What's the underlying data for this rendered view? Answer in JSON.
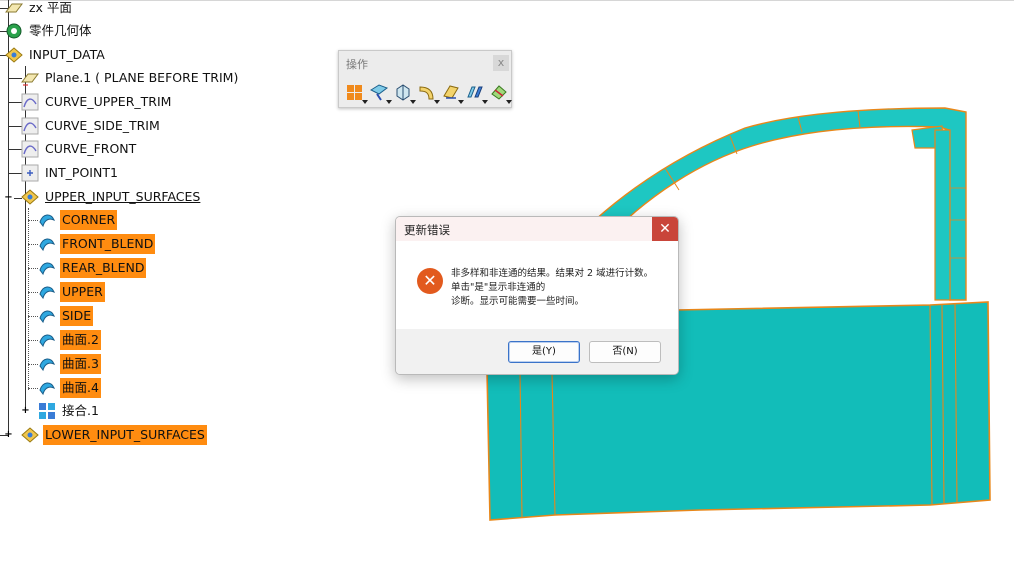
{
  "tree": {
    "items": [
      {
        "label": "zx 平面",
        "icon": "plane-icon",
        "highlight": false
      },
      {
        "label": "零件几何体",
        "icon": "part-body-icon",
        "highlight": false
      },
      {
        "label": "INPUT_DATA",
        "icon": "geometrical-set-icon",
        "highlight": false
      },
      {
        "label": "Plane.1 ( PLANE BEFORE TRIM)",
        "icon": "plane-icon",
        "highlight": false
      },
      {
        "label": "CURVE_UPPER_TRIM",
        "icon": "curve-icon",
        "highlight": false
      },
      {
        "label": "CURVE_SIDE_TRIM",
        "icon": "curve-icon",
        "highlight": false
      },
      {
        "label": "CURVE_FRONT",
        "icon": "curve-icon",
        "highlight": false
      },
      {
        "label": "INT_POINT1",
        "icon": "point-icon",
        "highlight": false
      },
      {
        "label": "UPPER_INPUT_SURFACES",
        "icon": "geometrical-set-icon",
        "highlight": false,
        "underline": true
      },
      {
        "label": "CORNER",
        "icon": "surface-icon",
        "highlight": true
      },
      {
        "label": "FRONT_BLEND",
        "icon": "surface-icon",
        "highlight": true
      },
      {
        "label": "REAR_BLEND",
        "icon": "surface-icon",
        "highlight": true
      },
      {
        "label": "UPPER",
        "icon": "surface-icon",
        "highlight": true
      },
      {
        "label": "SIDE",
        "icon": "surface-icon",
        "highlight": true
      },
      {
        "label": "曲面.2",
        "icon": "surface-icon",
        "highlight": true
      },
      {
        "label": "曲面.3",
        "icon": "surface-icon",
        "highlight": true
      },
      {
        "label": "曲面.4",
        "icon": "surface-icon",
        "highlight": true
      },
      {
        "label": "接合.1",
        "icon": "join-icon",
        "highlight": false
      },
      {
        "label": "LOWER_INPUT_SURFACES",
        "icon": "geometrical-set-icon",
        "highlight": true
      }
    ]
  },
  "toolbar": {
    "title": "操作",
    "close": "x",
    "buttons": [
      {
        "name": "join-tool-icon"
      },
      {
        "name": "healing-tool-icon"
      },
      {
        "name": "extract-tool-icon"
      },
      {
        "name": "fillet-tool-icon"
      },
      {
        "name": "translate-tool-icon"
      },
      {
        "name": "extrapolate-tool-icon"
      },
      {
        "name": "invert-tool-icon"
      }
    ]
  },
  "dialog": {
    "title": "更新错误",
    "close": "✕",
    "message_lines": [
      "非多样和非连通的结果。结果对 2 域进行计数。",
      "单击\"是\"显示非连通的",
      "诊断。显示可能需要一些时间。"
    ],
    "yes_label": "是(Y)",
    "no_label": "否(N)"
  },
  "colors": {
    "highlight": "#ff8c10",
    "surface": "#1ec7c2",
    "edge": "#e8871a",
    "error": "#e25a1e"
  }
}
